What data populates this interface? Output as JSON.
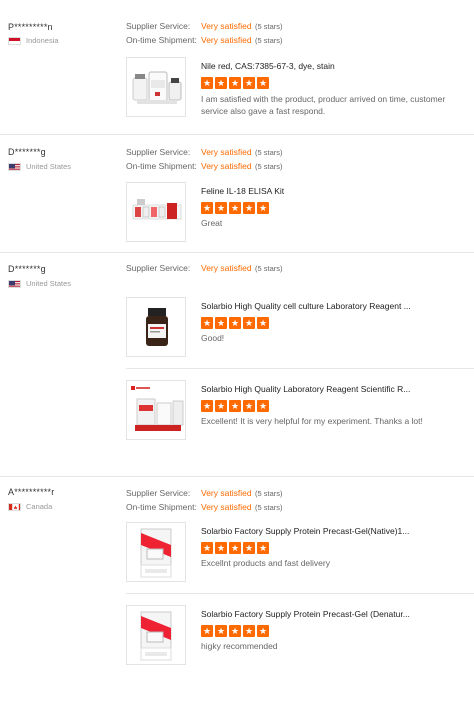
{
  "labels": {
    "supplier_service": "Supplier Service:",
    "ontime_shipment": "On-time Shipment:"
  },
  "star_glyph": "★",
  "reviews": [
    {
      "buyer": "P*********n",
      "country": "Indonesia",
      "flag": "indonesia-flag-icon",
      "supplier_value": "Very satisfied",
      "supplier_stars": "(5 stars)",
      "shipment_value": "Very satisfied",
      "shipment_stars": "(5 stars)",
      "products": [
        {
          "title": "Nile red, CAS:7385-67-3, dye, stain",
          "rating": 5,
          "comment": "I am satisfied with the product, producr arrived on time, customer service also gave a fast respond."
        }
      ]
    },
    {
      "buyer": "D*******g",
      "country": "United States",
      "flag": "usa-flag-icon",
      "supplier_value": "Very satisfied",
      "supplier_stars": "(5 stars)",
      "shipment_value": "Very satisfied",
      "shipment_stars": "(5 stars)",
      "products": [
        {
          "title": "Feline IL-18 ELISA Kit",
          "rating": 5,
          "comment": "Great"
        }
      ]
    },
    {
      "buyer": "D*******g",
      "country": "United States",
      "flag": "usa-flag-icon",
      "supplier_value": "Very satisfied",
      "supplier_stars": "(5 stars)",
      "products": [
        {
          "title": "Solarbio High Quality cell culture Laboratory Reagent ...",
          "rating": 5,
          "comment": "Good!"
        },
        {
          "title": "Solarbio High Quality Laboratory Reagent Scientific R...",
          "rating": 5,
          "comment": "Excellent! It is very helpful for my experiment. Thanks a lot!"
        }
      ]
    },
    {
      "buyer": "A**********r",
      "country": "Canada",
      "flag": "canada-flag-icon",
      "supplier_value": "Very satisfied",
      "supplier_stars": "(5 stars)",
      "shipment_value": "Very satisfied",
      "shipment_stars": "(5 stars)",
      "products": [
        {
          "title": "Solarbio Factory Supply Protein Precast-Gel(Native)1...",
          "rating": 5,
          "comment": "Excellnt products and fast delivery"
        },
        {
          "title": "Solarbio Factory Supply Protein Precast-Gel (Denatur...",
          "rating": 5,
          "comment": "higky recommended"
        }
      ]
    }
  ],
  "colors": {
    "accent": "#ff6a00",
    "divider": "#e6e6e6",
    "muted": "#999999"
  }
}
